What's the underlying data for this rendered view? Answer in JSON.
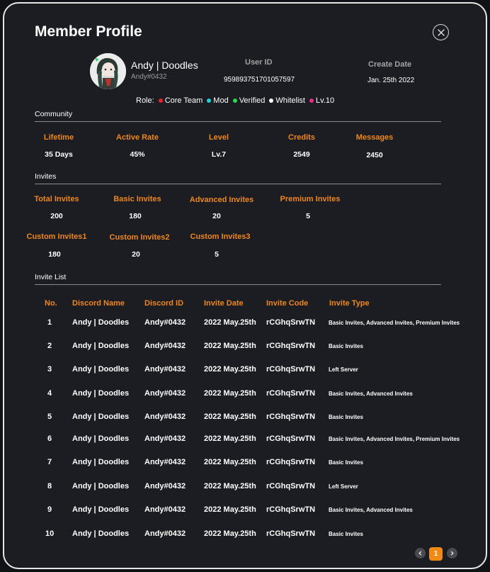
{
  "modal": {
    "title": "Member Profile"
  },
  "profile": {
    "display_name": "Andy | Doodles",
    "tag": "Andy#0432",
    "user_id_label": "User ID",
    "user_id": "959893751701057597",
    "create_date_label": "Create Date",
    "create_date": "Jan. 25th 2022",
    "role_label": "Role:",
    "roles": [
      {
        "label": "Core Team",
        "color": "#e8232a"
      },
      {
        "label": "Mod",
        "color": "#1fd1d8"
      },
      {
        "label": "Verified",
        "color": "#29d94a"
      },
      {
        "label": "Whitelist",
        "color": "#ffffff"
      },
      {
        "label": "Lv.10",
        "color": "#ec2a8a"
      }
    ]
  },
  "community": {
    "title": "Community",
    "stats": [
      {
        "label": "Lifetime",
        "value": "35 Days"
      },
      {
        "label": "Active Rate",
        "value": "45%"
      },
      {
        "label": "Level",
        "value": "Lv.7"
      },
      {
        "label": "Credits",
        "value": "2549"
      },
      {
        "label": "Messages",
        "value": "2450"
      }
    ]
  },
  "invites": {
    "title": "Invites",
    "stats": [
      {
        "label": "Total Invites",
        "value": "200"
      },
      {
        "label": "Basic Invites",
        "value": "180"
      },
      {
        "label": "Advanced Invites",
        "value": "20"
      },
      {
        "label": "Premium Invites",
        "value": "5"
      },
      {
        "label": "Custom Invites1",
        "value": "180"
      },
      {
        "label": "Custom Invites2",
        "value": "20"
      },
      {
        "label": "Custom Invites3",
        "value": "5"
      }
    ]
  },
  "invite_list": {
    "title": "Invite List",
    "columns": [
      "No.",
      "Discord Name",
      "Discord ID",
      "Invite Date",
      "Invite Code",
      "Invite Type"
    ],
    "rows": [
      [
        "1",
        "Andy | Doodles",
        "Andy#0432",
        "2022 May.25th",
        "rCGhqSrwTN",
        "Basic Invites, Advanced Invites, Premium Invites"
      ],
      [
        "2",
        "Andy | Doodles",
        "Andy#0432",
        "2022 May.25th",
        "rCGhqSrwTN",
        "Basic Invites"
      ],
      [
        "3",
        "Andy | Doodles",
        "Andy#0432",
        "2022 May.25th",
        "rCGhqSrwTN",
        "Left Server"
      ],
      [
        "4",
        "Andy | Doodles",
        "Andy#0432",
        "2022 May.25th",
        "rCGhqSrwTN",
        "Basic Invites, Advanced Invites"
      ],
      [
        "5",
        "Andy | Doodles",
        "Andy#0432",
        "2022 May.25th",
        "rCGhqSrwTN",
        "Basic Invites"
      ],
      [
        "6",
        "Andy | Doodles",
        "Andy#0432",
        "2022 May.25th",
        "rCGhqSrwTN",
        "Basic Invites, Advanced Invites, Premium Invites"
      ],
      [
        "7",
        "Andy | Doodles",
        "Andy#0432",
        "2022 May.25th",
        "rCGhqSrwTN",
        "Basic Invites"
      ],
      [
        "8",
        "Andy | Doodles",
        "Andy#0432",
        "2022 May.25th",
        "rCGhqSrwTN",
        "Left Server"
      ],
      [
        "9",
        "Andy | Doodles",
        "Andy#0432",
        "2022 May.25th",
        "rCGhqSrwTN",
        "Basic Invites, Advanced Invites"
      ],
      [
        "10",
        "Andy | Doodles",
        "Andy#0432",
        "2022 May.25th",
        "rCGhqSrwTN",
        "Basic Invites"
      ]
    ]
  },
  "pagination": {
    "current_page": "1",
    "prev_icon": "chevron-left-icon",
    "next_icon": "chevron-right-icon"
  },
  "icons": {
    "close": "close-icon",
    "avatar": "avatar"
  },
  "colors": {
    "accent": "#f08a14",
    "modal_bg": "#1c1d22",
    "border": "#e6e6e6"
  }
}
